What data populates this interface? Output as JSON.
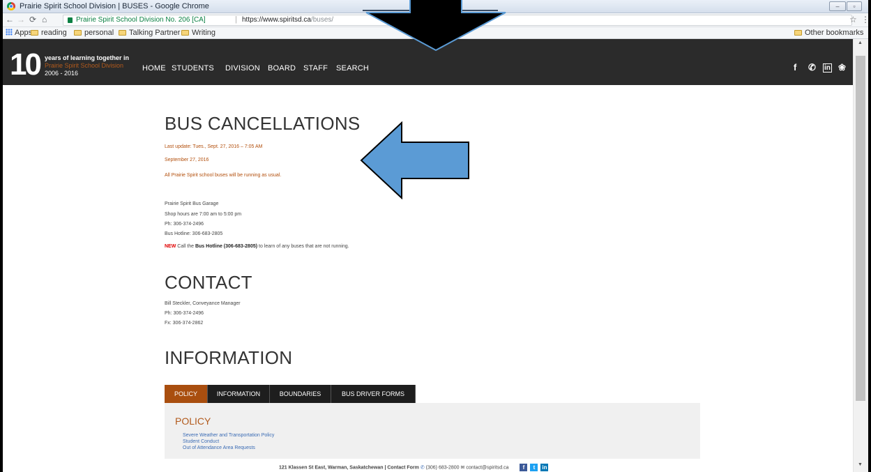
{
  "browser": {
    "window_title": "Prairie Spirit School Division | BUSES - Google Chrome",
    "site_identity": "Prairie Spirit School Division No. 206 [CA]",
    "url_host": "https://www.spiritsd.ca",
    "url_path": "/buses/",
    "win_min": "–",
    "win_max": "▫",
    "win_close": "✕",
    "bookmarks": [
      "Apps",
      "reading",
      "personal",
      "Talking Partner",
      "Writing"
    ],
    "other_bookmarks": "Other bookmarks"
  },
  "site": {
    "logo_number": "10",
    "logo_line1": "years of learning together in",
    "logo_line2": "Prairie Spirit School Division",
    "logo_line3": "2006 - 2016",
    "nav": [
      "HOME",
      "STUDENTS",
      "DIVISION",
      "BOARD",
      "STAFF",
      "SEARCH"
    ],
    "social": [
      "f",
      "✆",
      "in",
      "❀"
    ]
  },
  "bus": {
    "heading": "BUS CANCELLATIONS",
    "last_update": "Last update: Tues., Sept. 27, 2016 – 7:05 AM",
    "date": "September 27, 2016",
    "status": "All Prairie Spirit school buses will be running as usual.",
    "garage": "Prairie Spirit Bus Garage",
    "hours": "Shop hours are 7:00 am to 5:00 pm",
    "phone": "Ph: 306-374-2496",
    "hotline": "Bus Hotline: 306-683-2805",
    "notice_new": "NEW",
    "notice_a": " Call the ",
    "notice_b": "Bus Hotline (306-683-2805)",
    "notice_c": "  to learn of any buses that are not running."
  },
  "contact": {
    "heading": "CONTACT",
    "name": "Bill Steckler, Conveyance Manager",
    "phone": "Ph: 306-374-2496",
    "fax": "Fx: 306-374-2862"
  },
  "information": {
    "heading": "INFORMATION",
    "tabs": [
      "POLICY",
      "INFORMATION",
      "BOUNDARIES",
      "BUS DRIVER FORMS"
    ],
    "active_tab": "POLICY",
    "panel_title": "POLICY",
    "links": [
      "Severe Weather and Transportation Policy",
      "Student Conduct",
      "Out of Attendance Area Requests"
    ]
  },
  "footer": {
    "address": "121 Klassen St East, Warman, Saskatchewan | Contact Form",
    "phone": "(306) 683-2800",
    "email": "contact@spiritsd.ca"
  },
  "colors": {
    "nav_bg": "#2b2b2b",
    "accent_orange": "#a94e0f",
    "annotation_blue": "#5b9bd5",
    "link_blue": "#3a6bb4"
  },
  "icons": [
    "chrome-logo",
    "back-icon",
    "forward-icon",
    "reload-icon",
    "home-icon",
    "lock-icon",
    "star-icon",
    "menu-icon",
    "folder-icon",
    "facebook-icon",
    "twitter-icon",
    "linkedin-icon",
    "wordpress-icon",
    "phone-icon",
    "mail-icon"
  ]
}
